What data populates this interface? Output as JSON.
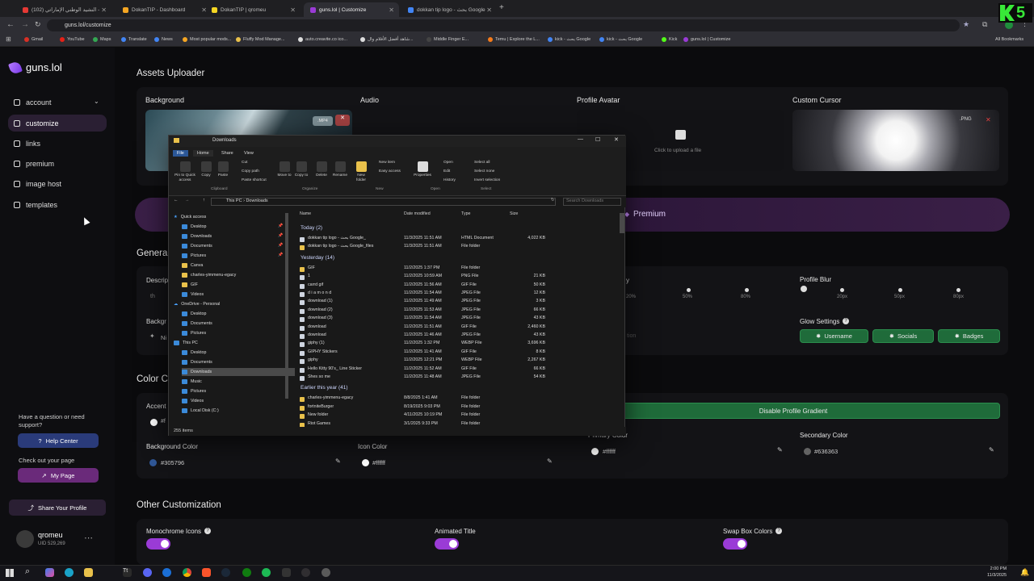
{
  "browser": {
    "tabs": [
      {
        "label": "(102) النشيد الوطني الإماراتي -",
        "color": "#e53935"
      },
      {
        "label": "DokanTIP - Dashboard",
        "color": "#f5a623"
      },
      {
        "label": "DokanTIP | qromeu",
        "color": "#f5d623"
      },
      {
        "label": "guns.lol | Customize",
        "color": "#9a3bd6",
        "active": true
      },
      {
        "label": "dokkan tip logo - بحث Google",
        "color": "#4285f4"
      }
    ],
    "url": "guns.lol/customize",
    "bookmarks": [
      "Gmail",
      "YouTube",
      "Maps",
      "Translate",
      "News",
      "Most popular mods...",
      "Fluffy Mod Manage...",
      "auto.creavite.co ico...",
      "شاهد أفضل الأفلام وال...",
      "Middle Finger E...",
      "Temu | Explore the L...",
      "kick - بحث Google",
      "kick - بحث Google",
      "Kick",
      "guns.lol | Customize"
    ],
    "all_bookmarks": "All Bookmarks",
    "window_number": "5"
  },
  "sidebar": {
    "brand": "guns.lol",
    "items": [
      {
        "label": "account",
        "icon": "users-icon"
      },
      {
        "label": "customize",
        "icon": "brush-icon",
        "selected": true
      },
      {
        "label": "links",
        "icon": "link-icon"
      },
      {
        "label": "premium",
        "icon": "diamond-icon"
      },
      {
        "label": "image host",
        "icon": "image-icon"
      },
      {
        "label": "templates",
        "icon": "layers-icon"
      }
    ],
    "help_question": "Have a question or need support?",
    "help_center": "Help Center",
    "check_page": "Check out your page",
    "my_page": "My Page",
    "share": "Share Your Profile",
    "user": {
      "name": "qromeu",
      "uid": "UID 529,269"
    }
  },
  "main": {
    "assets_title": "Assets Uploader",
    "assets": [
      {
        "label": "Background",
        "badge": ".MP4"
      },
      {
        "label": "Audio"
      },
      {
        "label": "Profile Avatar",
        "hint": "Click to upload a file"
      },
      {
        "label": "Custom Cursor",
        "badge": ".PNG"
      }
    ],
    "premium_label": "Premium",
    "general_title": "Genera",
    "description_label": "Descrip",
    "description_placeholder": "th",
    "background_label": "Backgr",
    "background_value": "Ni",
    "opacity_ticks": [
      "20%",
      "50%",
      "80%"
    ],
    "opacity_partial": "y",
    "profile_blur": {
      "label": "Profile Blur",
      "ticks": [
        "0px",
        "20px",
        "50px",
        "80px"
      ]
    },
    "location_partial": "tion",
    "glow": {
      "label": "Glow Settings",
      "buttons": [
        "Username",
        "Socials",
        "Badges"
      ]
    },
    "color_title": "Color C",
    "accent_label": "Accent",
    "accent_value": "#f",
    "disable_gradient": "Disable Profile Gradient",
    "colors": [
      {
        "label": "Background Color",
        "value": "#305796",
        "swatch": "#305796"
      },
      {
        "label": "Icon Color",
        "value": "#ffffff",
        "swatch": "#ffffff"
      },
      {
        "label": "Primary Color",
        "value": "#ffffff",
        "swatch": "#ffffff"
      },
      {
        "label": "Secondary Color",
        "value": "#636363",
        "swatch": "#636363"
      }
    ],
    "other_title": "Other Customization",
    "toggles": [
      {
        "label": "Monochrome Icons",
        "on": true
      },
      {
        "label": "Animated Title",
        "on": true
      },
      {
        "label": "Swap Box Colors",
        "on": true
      }
    ]
  },
  "explorer": {
    "title": "Downloads",
    "ribbon_tabs": [
      "File",
      "Home",
      "Share",
      "View"
    ],
    "clipboard": {
      "pin": "Pin to Quick access",
      "copy": "Copy",
      "paste": "Paste",
      "cut": "Cut",
      "copy_path": "Copy path",
      "paste_shortcut": "Paste shortcut",
      "group": "Clipboard"
    },
    "organize": {
      "move": "Move to",
      "copy": "Copy to",
      "delete": "Delete",
      "rename": "Rename",
      "group": "Organize"
    },
    "new": {
      "folder": "New folder",
      "item": "New item",
      "easy": "Easy access",
      "group": "New"
    },
    "open": {
      "properties": "Properties",
      "open": "Open",
      "edit": "Edit",
      "history": "History",
      "group": "Open"
    },
    "select": {
      "all": "Select all",
      "none": "Select none",
      "invert": "Invert selection",
      "group": "Select"
    },
    "path": [
      "This PC",
      "Downloads"
    ],
    "search_placeholder": "Search Downloads",
    "columns": [
      "Name",
      "Date modified",
      "Type",
      "Size"
    ],
    "tree": [
      {
        "label": "Quick access",
        "kind": "star"
      },
      {
        "label": "Desktop",
        "kind": "b",
        "pin": true
      },
      {
        "label": "Downloads",
        "kind": "b",
        "pin": true
      },
      {
        "label": "Documents",
        "kind": "b",
        "pin": true
      },
      {
        "label": "Pictures",
        "kind": "b",
        "pin": true
      },
      {
        "label": "Canva",
        "kind": "f"
      },
      {
        "label": "charles-yimmenu-egacy",
        "kind": "f"
      },
      {
        "label": "GIF",
        "kind": "f"
      },
      {
        "label": "Videos",
        "kind": "b"
      },
      {
        "label": "OneDrive - Personal",
        "kind": "cloud"
      },
      {
        "label": "Desktop",
        "kind": "b"
      },
      {
        "label": "Documents",
        "kind": "b"
      },
      {
        "label": "Pictures",
        "kind": "b"
      },
      {
        "label": "This PC",
        "kind": "pc"
      },
      {
        "label": "Desktop",
        "kind": "b"
      },
      {
        "label": "Documents",
        "kind": "b"
      },
      {
        "label": "Downloads",
        "kind": "b",
        "selected": true
      },
      {
        "label": "Music",
        "kind": "b"
      },
      {
        "label": "Pictures",
        "kind": "b"
      },
      {
        "label": "Videos",
        "kind": "b"
      },
      {
        "label": "Local Disk (C:)",
        "kind": "b"
      }
    ],
    "groups": [
      {
        "label": "Today (2)",
        "rows": [
          {
            "name": "dokkan tip logo - بحث Google_",
            "date": "11/3/2025 11:51 AM",
            "type": "HTML Document",
            "size": "4,022 KB"
          },
          {
            "name": "dokkan tip logo - بحث Google_files",
            "date": "11/3/2025 11:51 AM",
            "type": "File folder",
            "size": ""
          }
        ]
      },
      {
        "label": "Yesterday (14)",
        "rows": [
          {
            "name": "GIF",
            "date": "11/2/2025 1:37 PM",
            "type": "File folder",
            "size": ""
          },
          {
            "name": "1",
            "date": "11/2/2025 10:59 AM",
            "type": "PNG File",
            "size": "21 KB"
          },
          {
            "name": "carrd gif",
            "date": "11/2/2025 11:56 AM",
            "type": "GIF File",
            "size": "50 KB"
          },
          {
            "name": "d i a m o n d",
            "date": "11/2/2025 11:54 AM",
            "type": "JPEG File",
            "size": "12 KB"
          },
          {
            "name": "download (1)",
            "date": "11/2/2025 11:49 AM",
            "type": "JPEG File",
            "size": "3 KB"
          },
          {
            "name": "download (2)",
            "date": "11/2/2025 11:53 AM",
            "type": "JPEG File",
            "size": "66 KB"
          },
          {
            "name": "download (3)",
            "date": "11/2/2025 11:54 AM",
            "type": "JPEG File",
            "size": "43 KB"
          },
          {
            "name": "download",
            "date": "11/2/2025 11:51 AM",
            "type": "GIF File",
            "size": "2,460 KB"
          },
          {
            "name": "download",
            "date": "11/2/2025 11:46 AM",
            "type": "JPEG File",
            "size": "43 KB"
          },
          {
            "name": "giphy (1)",
            "date": "11/2/2025 1:32 PM",
            "type": "WEBP File",
            "size": "3,696 KB"
          },
          {
            "name": "GIPHY Stickers",
            "date": "11/2/2025 11:41 AM",
            "type": "GIF File",
            "size": "8 KB"
          },
          {
            "name": "giphy",
            "date": "11/2/2025 12:21 PM",
            "type": "WEBP File",
            "size": "2,267 KB"
          },
          {
            "name": "Hello Kitty 90's_ Line Sticker",
            "date": "11/2/2025 11:52 AM",
            "type": "GIF File",
            "size": "66 KB"
          },
          {
            "name": "Shes so me",
            "date": "11/2/2025 11:48 AM",
            "type": "JPEG File",
            "size": "54 KB"
          }
        ]
      },
      {
        "label": "Earlier this year (41)",
        "rows": [
          {
            "name": "charles-yimmenu-egacy",
            "date": "8/8/2025 1:41 AM",
            "type": "File folder",
            "size": ""
          },
          {
            "name": "fortniteBurger",
            "date": "8/19/2025 9:03 PM",
            "type": "File folder",
            "size": ""
          },
          {
            "name": "New folder",
            "date": "4/11/2025 10:19 PM",
            "type": "File folder",
            "size": ""
          },
          {
            "name": "Riot Games",
            "date": "3/1/2025 9:33 PM",
            "type": "File folder",
            "size": ""
          }
        ]
      }
    ],
    "status": "255 items"
  },
  "taskbar": {
    "time": "2:00 PM",
    "date": "11/3/2025"
  }
}
